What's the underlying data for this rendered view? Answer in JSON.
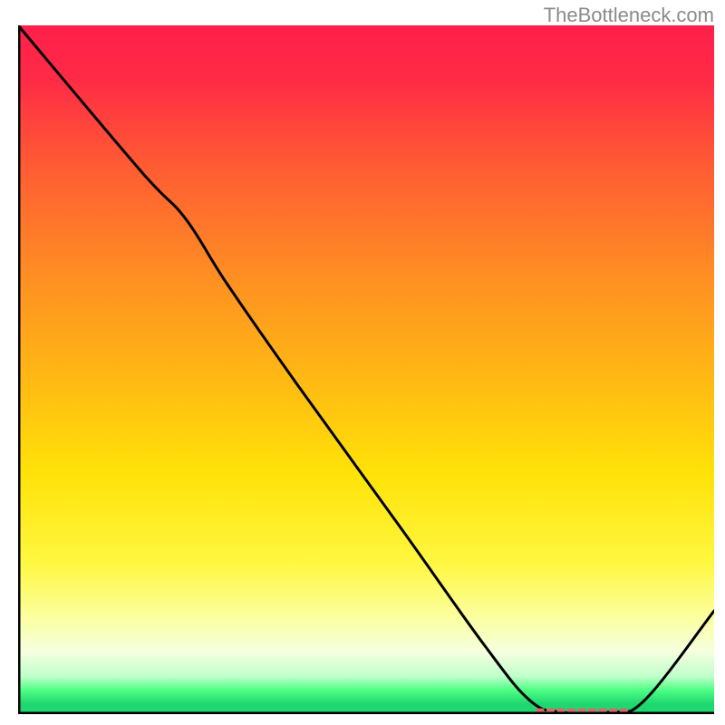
{
  "attribution": "TheBottleneck.com",
  "chart_data": {
    "type": "line",
    "title": "",
    "xlabel": "",
    "ylabel": "",
    "xlim": [
      0,
      100
    ],
    "ylim": [
      0,
      100
    ],
    "gradient_stops": [
      {
        "offset": 0.0,
        "color": "#ff1f4b"
      },
      {
        "offset": 0.08,
        "color": "#ff2b46"
      },
      {
        "offset": 0.2,
        "color": "#ff5a34"
      },
      {
        "offset": 0.35,
        "color": "#ff8a24"
      },
      {
        "offset": 0.5,
        "color": "#ffb515"
      },
      {
        "offset": 0.65,
        "color": "#ffe208"
      },
      {
        "offset": 0.78,
        "color": "#fff740"
      },
      {
        "offset": 0.86,
        "color": "#fbffa0"
      },
      {
        "offset": 0.91,
        "color": "#f5ffdf"
      },
      {
        "offset": 0.945,
        "color": "#c0ffcb"
      },
      {
        "offset": 0.965,
        "color": "#4eff85"
      },
      {
        "offset": 0.985,
        "color": "#1fd76f"
      },
      {
        "offset": 1.0,
        "color": "#1fd76f"
      }
    ],
    "series": [
      {
        "name": "curve",
        "color": "#000000",
        "points": [
          {
            "x": 0.0,
            "y": 100.0
          },
          {
            "x": 17.5,
            "y": 79.0
          },
          {
            "x": 24.0,
            "y": 72.0
          },
          {
            "x": 30.0,
            "y": 62.5
          },
          {
            "x": 40.0,
            "y": 48.0
          },
          {
            "x": 55.0,
            "y": 27.0
          },
          {
            "x": 67.0,
            "y": 10.0
          },
          {
            "x": 73.5,
            "y": 2.0
          },
          {
            "x": 78.0,
            "y": 0.3
          },
          {
            "x": 85.0,
            "y": 0.3
          },
          {
            "x": 90.0,
            "y": 2.0
          },
          {
            "x": 100.0,
            "y": 15.0
          }
        ]
      }
    ],
    "marks": {
      "name": "bottom-marks",
      "color": "#d46a6a",
      "points": [
        {
          "x": 75.0,
          "y": 0.25
        },
        {
          "x": 76.5,
          "y": 0.25
        },
        {
          "x": 78.0,
          "y": 0.25
        },
        {
          "x": 79.5,
          "y": 0.25
        },
        {
          "x": 81.0,
          "y": 0.25
        },
        {
          "x": 82.5,
          "y": 0.25
        },
        {
          "x": 84.0,
          "y": 0.25
        },
        {
          "x": 85.5,
          "y": 0.25
        },
        {
          "x": 87.0,
          "y": 0.25
        }
      ]
    }
  }
}
